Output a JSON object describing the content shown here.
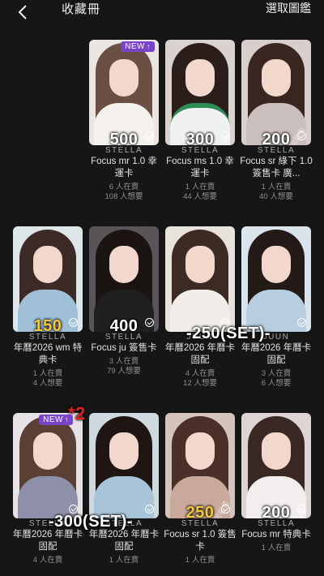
{
  "header": {
    "title": "收藏冊",
    "select_label": "選取圖鑑"
  },
  "cards": [
    {
      "price": "500",
      "price_color": "#ffffff",
      "brand": "STELLA",
      "name": "Focus mr 1.0 幸運卡",
      "selling": "6 人在賣",
      "wanting": "108 人想要",
      "new_badge": "NEW",
      "watermark": ""
    },
    {
      "price": "300",
      "price_color": "#ffffff",
      "brand": "STELLA",
      "name": "Focus ms 1.0 幸運卡",
      "selling": "1 人在賣",
      "wanting": "44 人想要",
      "new_badge": "",
      "watermark": ""
    },
    {
      "price": "200",
      "price_color": "#ffffff",
      "brand": "STELLA",
      "name": "Focus sr 綠下 1.0 簽售卡 廣...",
      "selling": "1 人在賣",
      "wanting": "40 人想要",
      "new_badge": "",
      "watermark": "Stony 張河鬆美"
    },
    {
      "price": "150",
      "price_color": "#f5c842",
      "brand": "STELLA",
      "name": "年曆2026 wm 特典卡",
      "selling": "1 人在賣",
      "wanting": "4 人想要",
      "new_badge": "",
      "watermark": ""
    },
    {
      "price": "400",
      "price_color": "#ffffff",
      "brand": "STELLA",
      "name": "Focus ju 簽售卡",
      "selling": "3 人在賣",
      "wanting": "79 人想要",
      "new_badge": "",
      "watermark": ""
    },
    {
      "price": "",
      "price_color": "#ffffff",
      "brand": "JUUN",
      "name": "年曆2026 年曆卡 固配",
      "selling": "4 人在賣",
      "wanting": "12 人想要",
      "new_badge": "",
      "watermark": ""
    },
    {
      "price": "",
      "price_color": "#ffffff",
      "brand": "JUUN",
      "name": "年曆2026 年曆卡 固配",
      "selling": "3 人在賣",
      "wanting": "6 人想要",
      "new_badge": "",
      "watermark": ""
    },
    {
      "price": "",
      "price_color": "#ffffff",
      "brand": "STELLA",
      "name": "年曆2026 年曆卡 固配",
      "selling": "4 人在賣",
      "wanting": "",
      "new_badge": "NEW",
      "watermark": ""
    },
    {
      "price": "",
      "price_color": "#ffffff",
      "brand": "STELLA",
      "name": "年曆2026 年曆卡 固配",
      "selling": "1 人在賣",
      "wanting": "",
      "new_badge": "",
      "watermark": ""
    },
    {
      "price": "250",
      "price_color": "#f5c842",
      "brand": "STELLA",
      "name": "Focus sr 1.0 簽售卡",
      "selling": "1 人在賣",
      "wanting": "",
      "new_badge": "",
      "watermark": "Stony 張河鬆美"
    },
    {
      "price": "200",
      "price_color": "#ffffff",
      "brand": "STELLA",
      "name": "Focus mr 特典卡",
      "selling": "1 人在賣",
      "wanting": "",
      "new_badge": "",
      "watermark": ""
    }
  ],
  "overlays": {
    "set_price_row2": "-250(SET)-",
    "set_price_row3": "-300(SET)-",
    "red_mark": "*2"
  },
  "colors": {
    "background": "#161616",
    "new_badge": "#7a44c9",
    "gold_price": "#f5c842",
    "red_mark": "#e02020"
  }
}
